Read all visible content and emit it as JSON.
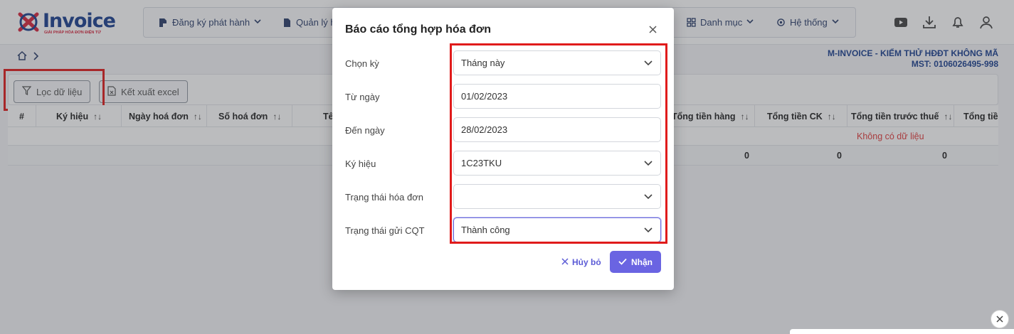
{
  "app": {
    "logo_text": "Invoice",
    "logo_tagline": "GIẢI PHÁP HÓA ĐƠN ĐIỆN TỬ",
    "menu": [
      {
        "label": "Đăng ký phát hành",
        "icon": "document-edit-icon"
      },
      {
        "label": "Quản lý h",
        "icon": "document-icon"
      },
      {
        "label": "Danh mục",
        "icon": "grid-icon"
      },
      {
        "label": "Hệ thống",
        "icon": "gear-icon"
      }
    ],
    "top_icons": [
      "youtube-icon",
      "download-icon",
      "bell-icon",
      "user-icon"
    ],
    "company_name": "M-INVOICE - KIỂM THỬ HĐĐT KHÔNG MÃ",
    "company_tax": "MST: 0106026495-998",
    "toolbar": {
      "filter_label": "Lọc dữ liệu",
      "export_label": "Kết xuất excel"
    },
    "grid": {
      "headers": [
        "#",
        "Ký hiệu",
        "Ngày hoá đơn",
        "Số hoá đơn",
        "Tê",
        "Tổng tiền hàng",
        "Tổng tiền CK",
        "Tổng tiền trước thuế",
        "Tổng tiền"
      ],
      "sort_glyph": "↑↓",
      "empty_text": "Không có dữ liệu",
      "totals": [
        "0",
        "0",
        "0"
      ]
    }
  },
  "modal": {
    "title": "Báo cáo tổng hợp hóa đơn",
    "fields": [
      {
        "label": "Chọn kỳ",
        "value": "Tháng này",
        "dropdown": true
      },
      {
        "label": "Từ ngày",
        "value": "01/02/2023",
        "dropdown": false
      },
      {
        "label": "Đến ngày",
        "value": "28/02/2023",
        "dropdown": false
      },
      {
        "label": "Ký hiệu",
        "value": "1C23TKU",
        "dropdown": true
      },
      {
        "label": "Trạng thái hóa đơn",
        "value": "",
        "dropdown": true
      },
      {
        "label": "Trạng thái gửi CQT",
        "value": "Thành công",
        "dropdown": true
      }
    ],
    "cancel_label": "Hủy bỏ",
    "ok_label": "Nhận"
  },
  "colors": {
    "accent": "#6a64e2",
    "highlight": "#e01b1b",
    "brand": "#1b3f8f",
    "nodata": "#e23b3b"
  }
}
